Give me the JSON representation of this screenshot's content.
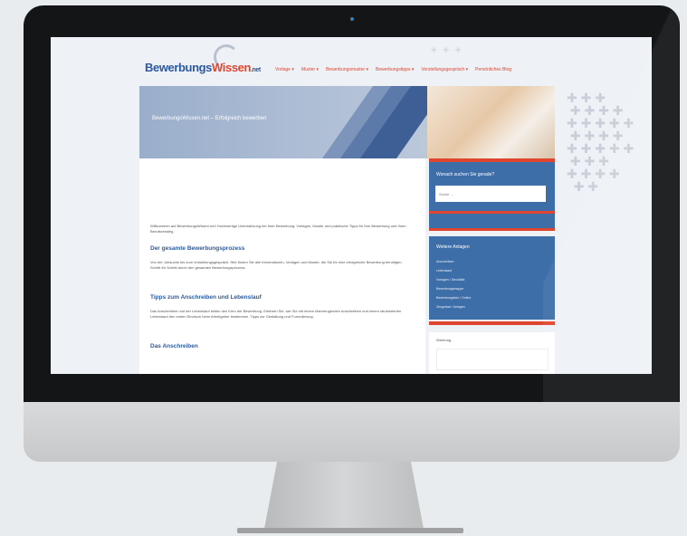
{
  "website": {
    "logo": {
      "main": "Bewerbungs",
      "accent": "Wissen",
      "suffix": ".net"
    },
    "nav": [
      "Vorlage",
      "Muster",
      "Bewerbungsmuster",
      "Bewerbungstipps",
      "Vorstellungsgespräch",
      "Persönliches Blog"
    ],
    "hero_title": "BewerbungsWissen.net – Erfolgreich bewerben",
    "intro": "Willkommen auf BewerbungsWissen.net! Hochwertige Unterstützung bei Ihrer Bewerbung: Vorlagen, Muster und praktische Tipps für Ihre Bewerbung und Ihren Berufseinstieg.",
    "sections": [
      {
        "heading": "Der gesamte Bewerbungsprozess",
        "text": "Von der Jobsuche bis zum Vorstellungsgespräch: Hier finden Sie alle Informationen, Vorlagen und Muster, die Sie für eine erfolgreiche Bewerbung benötigen. Schritt für Schritt durch den gesamten Bewerbungsprozess."
      },
      {
        "heading": "Tipps zum Anschreiben und Lebenslauf",
        "text": "Das Anschreiben und der Lebenslauf bilden den Kern der Bewerbung. Erfahren Sie, wie Sie mit einem überzeugenden Anschreiben und einem strukturierten Lebenslauf den ersten Eindruck beim Arbeitgeber bestimmen. Tipps zur Gestaltung und Formulierung."
      },
      {
        "heading": "Das Anschreiben",
        "text": ""
      }
    ],
    "sidebar": {
      "search_title": "Wonach suchen Sie gerade?",
      "search_placeholder": "Suche ...",
      "categories_title": "Weitere Anlagen",
      "categories": [
        "Anschreiben",
        "Lebenslauf",
        "Vorlagen / Deckblatt",
        "Bewerbungsmappe",
        "Bewerbungsfoto / Online",
        "Zeugnisse / Anlagen"
      ],
      "ad_title": "Werbung"
    }
  },
  "colors": {
    "accent": "#e0452f",
    "brand": "#2c5aa0",
    "sidebar": "#3e6ea8"
  }
}
